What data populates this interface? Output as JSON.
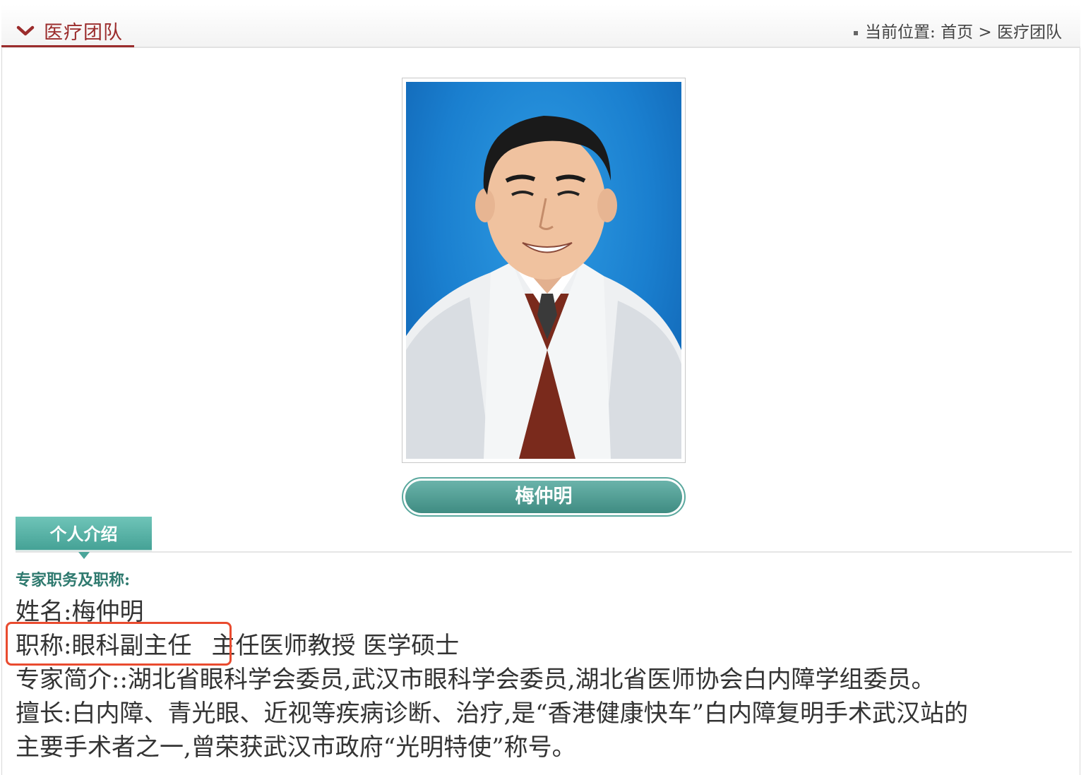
{
  "header": {
    "section_title": "医疗团队",
    "breadcrumb": {
      "prefix": "当前位置:",
      "home": "首页",
      "separator": ">",
      "current": "医疗团队"
    }
  },
  "doctor": {
    "name": "梅仲明"
  },
  "tab": {
    "label": "个人介绍"
  },
  "profile": {
    "subheading": "专家职务及职称:",
    "name_line": "姓名:梅仲明",
    "title_highlighted": "职称:眼科副主任",
    "title_rest": "主任医师教授 医学硕士",
    "intro_line": "专家简介::湖北省眼科学会委员,武汉市眼科学会委员,湖北省医师协会白内障学组委员。",
    "specialty_line1": "擅长:白内障、青光眼、近视等疾病诊断、治疗,是“香港健康快车”白内障复明手术武汉站的",
    "specialty_line2": "主要手术者之一,曾荣获武汉市政府“光明特使”称号。"
  },
  "colors": {
    "accent_red": "#9b2c2c",
    "teal": "#4aa59a",
    "highlight": "#e94b2f"
  },
  "icons": {
    "chevron": "chevron-down-icon",
    "breadcrumb_bullet": "square-bullet-icon"
  }
}
